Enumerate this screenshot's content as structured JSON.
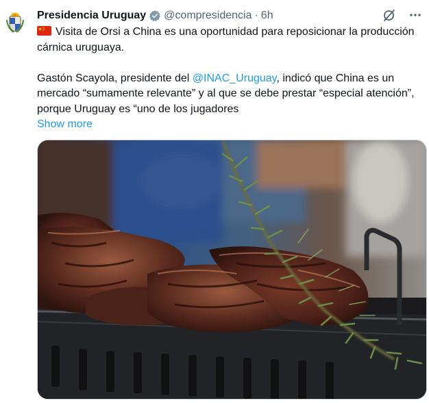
{
  "tweet": {
    "author_name": "Presidencia Uruguay",
    "handle": "@compresidencia",
    "separator": "·",
    "time": "6h",
    "text_line1": "Visita de Orsi a China es una oportunidad para reposicionar la producción cárnica uruguaya.",
    "text_part1": "Gastón Scayola, presidente del ",
    "mention": "@INAC_Uruguay",
    "text_part2": ", indicó que China es un mercado “sumamente relevante” y al que se debe prestar “especial atención”, porque Uruguay es “uno de los jugadores",
    "show_more": "Show more"
  },
  "icons": {
    "avatar": "uruguay-coat-of-arms",
    "verified": "verified-badge-icon",
    "flag": "china-flag-emoji",
    "grok": "grok-icon",
    "more": "more-icon"
  },
  "colors": {
    "text": "#0f1419",
    "secondary": "#536471",
    "link": "#1d9bf0"
  }
}
